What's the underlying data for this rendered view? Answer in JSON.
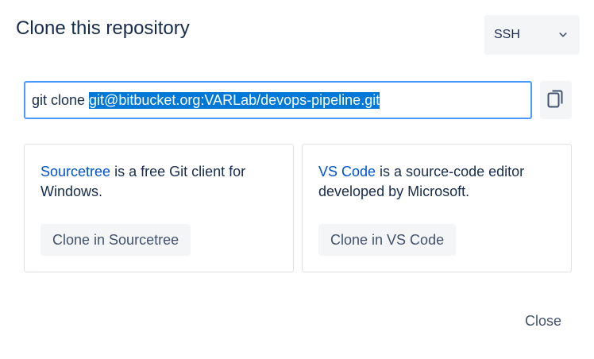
{
  "dialog": {
    "title": "Clone this repository",
    "close_label": "Close"
  },
  "protocol": {
    "selected": "SSH",
    "icon": "chevron-down-icon"
  },
  "clone_command": {
    "prefix": "git clone ",
    "url": "git@bitbucket.org:VARLab/devops-pipeline.git",
    "copy_icon": "copy-icon"
  },
  "apps": [
    {
      "name": "Sourcetree",
      "description_line1": " is a free Git client for",
      "description_line2": "Windows.",
      "button_label": "Clone in Sourcetree"
    },
    {
      "name": "VS Code",
      "description_line1": " is a source-code editor",
      "description_line2": "developed by Microsoft.",
      "button_label": "Clone in VS Code"
    }
  ],
  "colors": {
    "accent": "#0052cc",
    "focus_border": "#4c9aff",
    "selection": "#0078d7",
    "subtle_bg": "#f4f5f7"
  }
}
